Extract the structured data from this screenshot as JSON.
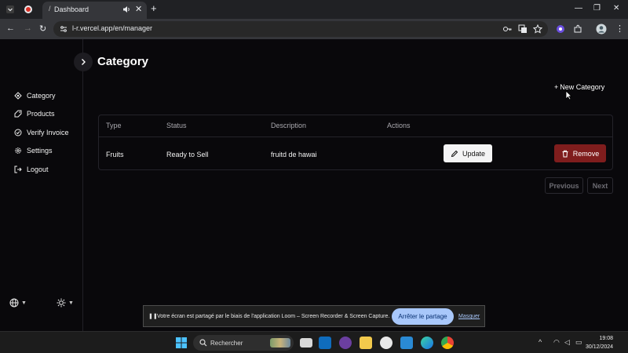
{
  "browser": {
    "tab_title": "Dashboard",
    "url": "l-r.vercel.app/en/manager",
    "new_tab": "+",
    "tab_close": "✕",
    "minimize": "—",
    "restore": "❐",
    "close": "✕"
  },
  "sidebar": {
    "items": [
      {
        "label": "Category",
        "icon": "category-icon"
      },
      {
        "label": "Products",
        "icon": "tag-icon"
      },
      {
        "label": "Verify Invoice",
        "icon": "check-badge-icon"
      },
      {
        "label": "Settings",
        "icon": "gear-icon"
      },
      {
        "label": "Logout",
        "icon": "logout-icon"
      }
    ]
  },
  "page": {
    "title": "Category",
    "new_button": "New Category"
  },
  "table": {
    "headers": {
      "type": "Type",
      "status": "Status",
      "description": "Description",
      "actions": "Actions"
    },
    "rows": [
      {
        "type": "Fruits",
        "status": "Ready to Sell",
        "description": "fruitd de hawai",
        "update": "Update",
        "remove": "Remove"
      }
    ]
  },
  "pagination": {
    "previous": "Previous",
    "next": "Next"
  },
  "loom": {
    "message": "Votre écran est partagé par le biais de l'application Loom – Screen Recorder & Screen Capture.",
    "stop": "Arrêter le partage",
    "hide": "Masquer"
  },
  "taskbar": {
    "search_placeholder": "Rechercher",
    "time": "19:08",
    "date": "30/12/2024"
  },
  "colors": {
    "background": "#09080b",
    "remove_button": "#7f1d1d",
    "update_button": "#f4f4f5",
    "loom_button": "#a8c7fa"
  }
}
